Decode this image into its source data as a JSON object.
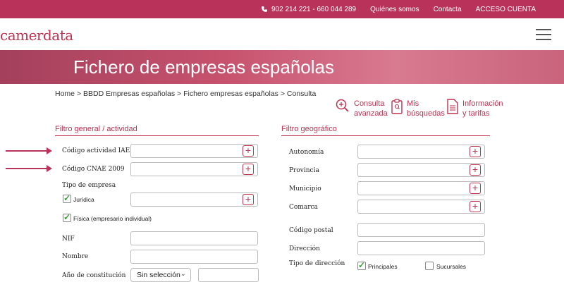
{
  "topbar": {
    "phone": "902 214 221 - 660 044 289",
    "about": "Quiénes somos",
    "contact": "Contacta",
    "account": "ACCESO CUENTA"
  },
  "header": {
    "logo": "camerdata"
  },
  "banner": {
    "title": "Fichero de empresas españolas"
  },
  "breadcrumb": "Home > BBDD Empresas españolas > Fichero empresas españolas > Consulta",
  "quick_links": {
    "advanced_1": "Consulta",
    "advanced_2": "avanzada",
    "searches_1": "Mis",
    "searches_2": "búsquedas",
    "info_1": "Información",
    "info_2": "y tarifas"
  },
  "general": {
    "title": "Filtro general / actividad",
    "iae": "Código actividad IAE",
    "cnae": "Código CNAE 2009",
    "tipo": "Tipo de empresa",
    "juridica": "Jurídica",
    "fisica": "Física (empresario individual)",
    "nif": "NIF",
    "nombre": "Nombre",
    "anio": "Año de constitución",
    "anio_select": "Sin selección"
  },
  "geo": {
    "title": "Filtro geográfico",
    "autonomia": "Autonomía",
    "provincia": "Provincia",
    "municipio": "Municipio",
    "comarca": "Comarca",
    "cp": "Código postal",
    "direccion": "Dirección",
    "tipo_dir": "Tipo de dirección",
    "principales": "Principales",
    "sucursales": "Sucursales"
  },
  "checkbox_state": {
    "juridica": true,
    "fisica": true,
    "principales": true,
    "sucursales": false
  },
  "colors": {
    "brand": "#b8325a",
    "accent": "#c0304f",
    "check": "#3a9b3a"
  }
}
